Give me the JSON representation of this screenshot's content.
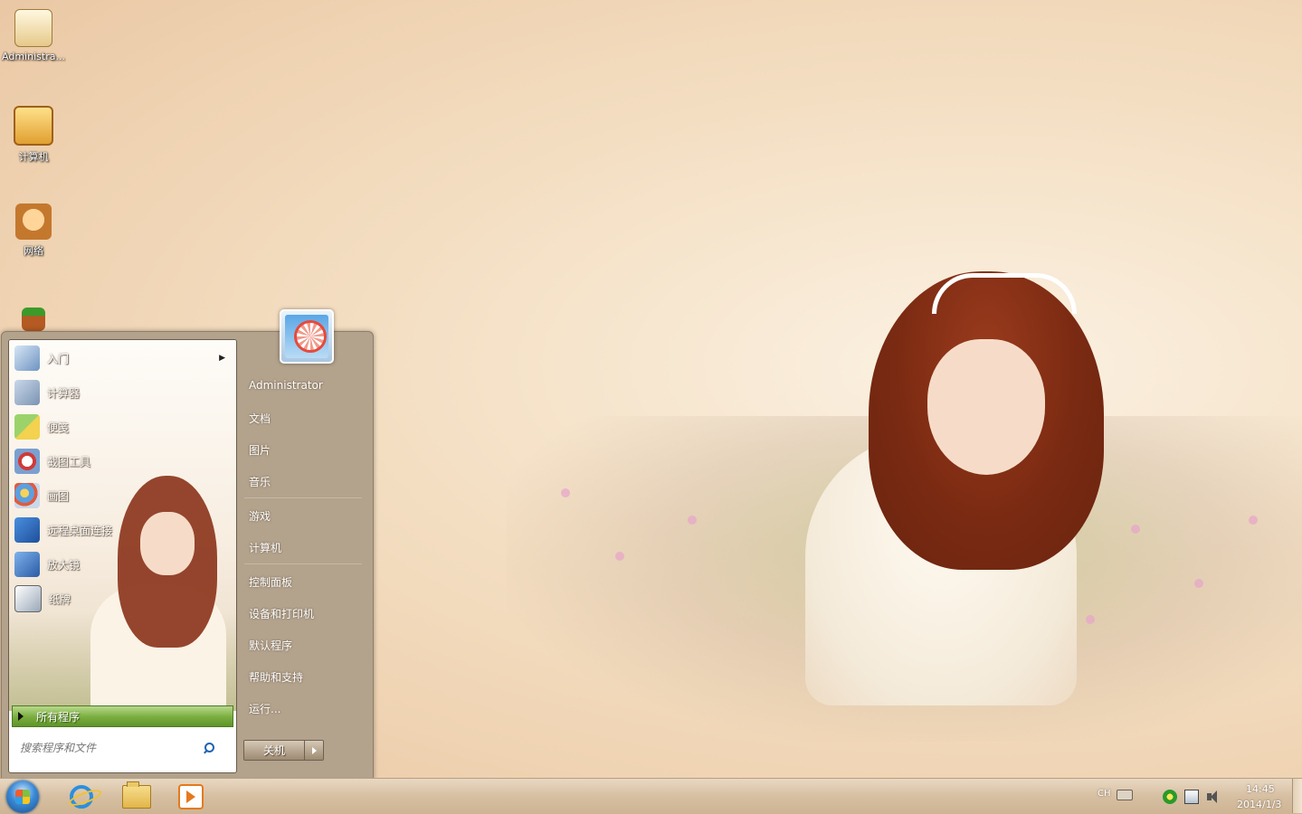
{
  "desktop": {
    "icons": [
      {
        "label": "Administra...",
        "icon": "document-icon"
      },
      {
        "label": "计算机",
        "icon": "computer-icon"
      },
      {
        "label": "网络",
        "icon": "network-icon"
      },
      {
        "label": "",
        "icon": "plant-pot-icon"
      }
    ]
  },
  "start_menu": {
    "programs": [
      {
        "label": "入门",
        "icon": "getting-started-icon",
        "has_submenu": true
      },
      {
        "label": "计算器",
        "icon": "calculator-icon"
      },
      {
        "label": "便笺",
        "icon": "sticky-notes-icon"
      },
      {
        "label": "截图工具",
        "icon": "snipping-tool-icon"
      },
      {
        "label": "画图",
        "icon": "paint-icon"
      },
      {
        "label": "远程桌面连接",
        "icon": "remote-desktop-icon"
      },
      {
        "label": "放大镜",
        "icon": "magnifier-icon"
      },
      {
        "label": "纸牌",
        "icon": "solitaire-icon"
      }
    ],
    "all_programs": "所有程序",
    "search_placeholder": "搜索程序和文件",
    "user_picture": "user-picture-ferris-wheel",
    "right_items": {
      "user": "Administrator",
      "documents": "文档",
      "pictures": "图片",
      "music": "音乐",
      "games": "游戏",
      "computer": "计算机",
      "control_panel": "控制面板",
      "devices": "设备和打印机",
      "default_programs": "默认程序",
      "help": "帮助和支持",
      "run": "运行..."
    },
    "shutdown": "关机"
  },
  "taskbar": {
    "pinned": [
      "internet-explorer-icon",
      "file-explorer-icon",
      "media-player-icon"
    ],
    "tray": {
      "language": "CH",
      "time": "14:45",
      "date": "2014/1/3"
    }
  },
  "colors": {
    "start_menu_bg": "#b3a28c",
    "all_programs_bar": "#79ad3e",
    "taskbar_bg": "#d6bfa2"
  }
}
